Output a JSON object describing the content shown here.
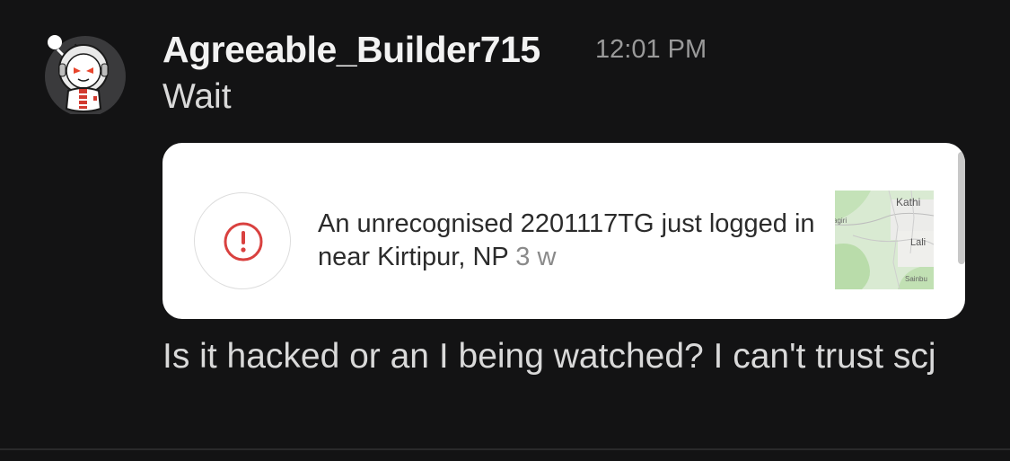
{
  "message": {
    "username": "Agreeable_Builder715",
    "timestamp": "12:01 PM",
    "text_before": "Wait",
    "text_after": "Is it hacked or an I being watched? I can't trust scj"
  },
  "attachment": {
    "notification_text": "An unrecognised 2201117TG just logged in near Kirtipur, NP",
    "notification_age": "3 w",
    "alert_icon": "alert-exclamation-icon",
    "map_labels": {
      "top": "Kathi",
      "left": "agiri",
      "middle": "Lali",
      "bottom": "Sainbu"
    }
  },
  "colors": {
    "background": "#131314",
    "alert_red": "#d9413f",
    "map_green": "#cfe7c4"
  }
}
